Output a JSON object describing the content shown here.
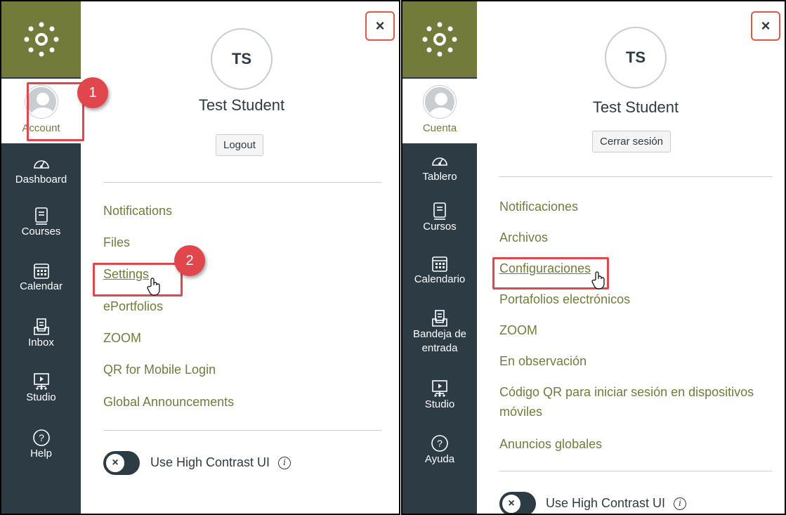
{
  "english": {
    "account_label": "Account",
    "nav_items": [
      {
        "label": "Dashboard",
        "icon": "dashboard-icon"
      },
      {
        "label": "Courses",
        "icon": "courses-icon"
      },
      {
        "label": "Calendar",
        "icon": "calendar-icon"
      },
      {
        "label": "Inbox",
        "icon": "inbox-icon"
      },
      {
        "label": "Studio",
        "icon": "studio-icon"
      },
      {
        "label": "Help",
        "icon": "help-icon"
      }
    ],
    "close_label": "×",
    "initials": "TS",
    "user_name": "Test Student",
    "logout_label": "Logout",
    "links": [
      "Notifications",
      "Files",
      "Settings",
      "ePortfolios",
      "ZOOM",
      "QR for Mobile Login",
      "Global Announcements"
    ],
    "toggle_label": "Use High Contrast UI",
    "toggle_knob": "×",
    "info": "i",
    "steps": [
      "1",
      "2"
    ]
  },
  "spanish": {
    "account_label": "Cuenta",
    "nav_items": [
      {
        "label": "Tablero",
        "icon": "dashboard-icon"
      },
      {
        "label": "Cursos",
        "icon": "courses-icon"
      },
      {
        "label": "Calendario",
        "icon": "calendar-icon"
      },
      {
        "label_line1": "Bandeja de",
        "label_line2": "entrada",
        "icon": "inbox-icon"
      },
      {
        "label": "Studio",
        "icon": "studio-icon"
      },
      {
        "label": "Ayuda",
        "icon": "help-icon"
      }
    ],
    "close_label": "×",
    "initials": "TS",
    "user_name": "Test Student",
    "logout_label": "Cerrar sesión",
    "links": [
      "Notificaciones",
      "Archivos",
      "Configuraciones",
      "Portafolios electrónicos",
      "ZOOM",
      "En observación",
      "Código QR para iniciar sesión en dispositivos móviles",
      "Anuncios globales"
    ],
    "toggle_label": "Use High Contrast UI",
    "toggle_knob": "×",
    "info": "i"
  },
  "colors": {
    "nav_bg": "#2d3b45",
    "brand": "#737b3b",
    "highlight": "#e0464b"
  }
}
